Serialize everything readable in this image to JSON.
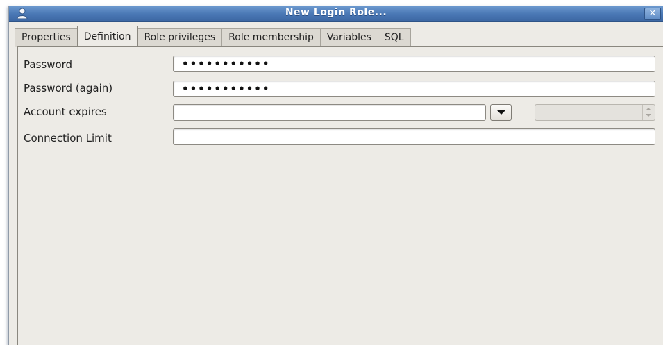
{
  "window": {
    "title": "New Login Role...",
    "close_glyph": "✕",
    "icon": "user-icon"
  },
  "tabs": [
    {
      "label": "Properties",
      "active": false
    },
    {
      "label": "Definition",
      "active": true
    },
    {
      "label": "Role privileges",
      "active": false
    },
    {
      "label": "Role membership",
      "active": false
    },
    {
      "label": "Variables",
      "active": false
    },
    {
      "label": "SQL",
      "active": false
    }
  ],
  "form": {
    "password": {
      "label": "Password",
      "masked_value": "•••••••••••"
    },
    "password_again": {
      "label": "Password (again)",
      "masked_value": "•••••••••••"
    },
    "account_expires": {
      "label": "Account expires",
      "value": "",
      "time_value": ""
    },
    "connection_limit": {
      "label": "Connection Limit",
      "value": ""
    }
  },
  "colors": {
    "titlebar": "#4a78b5",
    "window_bg": "#edebe6",
    "field_bg": "#ffffff"
  }
}
